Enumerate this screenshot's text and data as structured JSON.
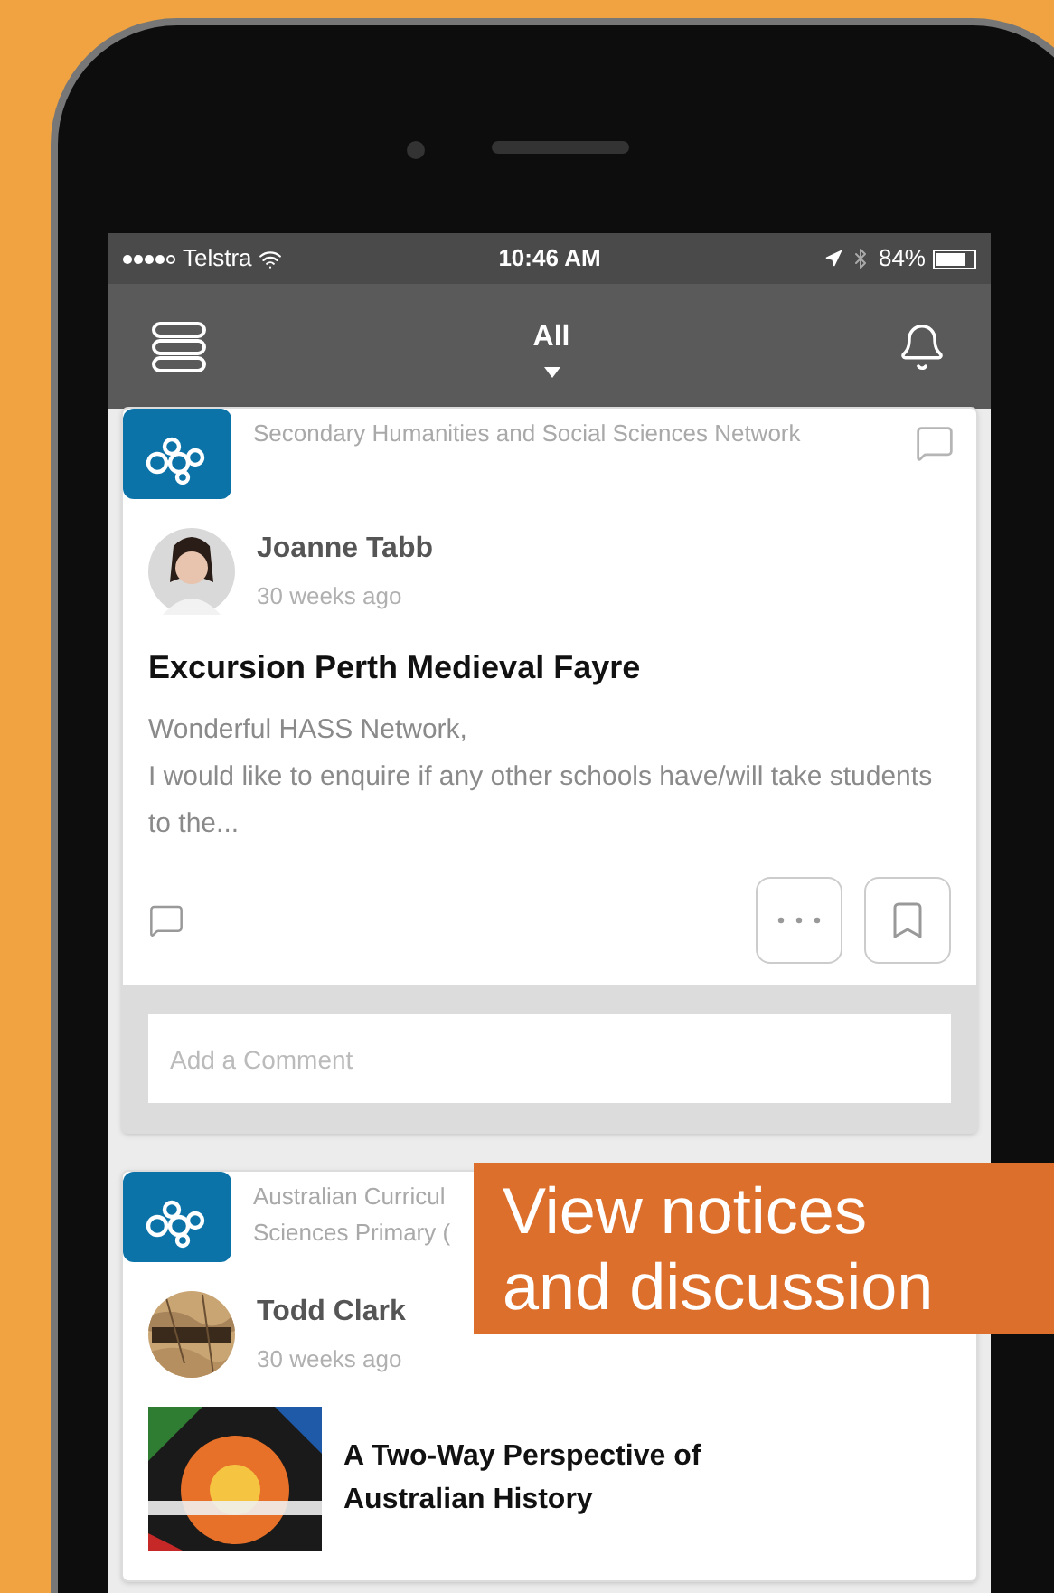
{
  "status_bar": {
    "carrier": "Telstra",
    "time": "10:46 AM",
    "battery": "84%"
  },
  "nav": {
    "title": "All"
  },
  "posts": [
    {
      "kind": "text",
      "group_lines": [
        "Secondary Humanities and Social Sciences Network"
      ],
      "author": "Joanne Tabb",
      "time": "30 weeks ago",
      "title": "Excursion Perth Medieval Fayre",
      "body": [
        "Wonderful HASS Network,",
        "I would like to enquire if any other schools have/will take students to the..."
      ],
      "comment_placeholder": "Add a Comment"
    },
    {
      "kind": "thumbnail",
      "group_lines": [
        "Australian Curricul",
        "Sciences Primary ("
      ],
      "author": "Todd Clark",
      "time": "30 weeks ago",
      "title": "A Two-Way Perspective of Australian History"
    }
  ],
  "banner": {
    "lines": [
      "View notices",
      "and discussion"
    ]
  }
}
